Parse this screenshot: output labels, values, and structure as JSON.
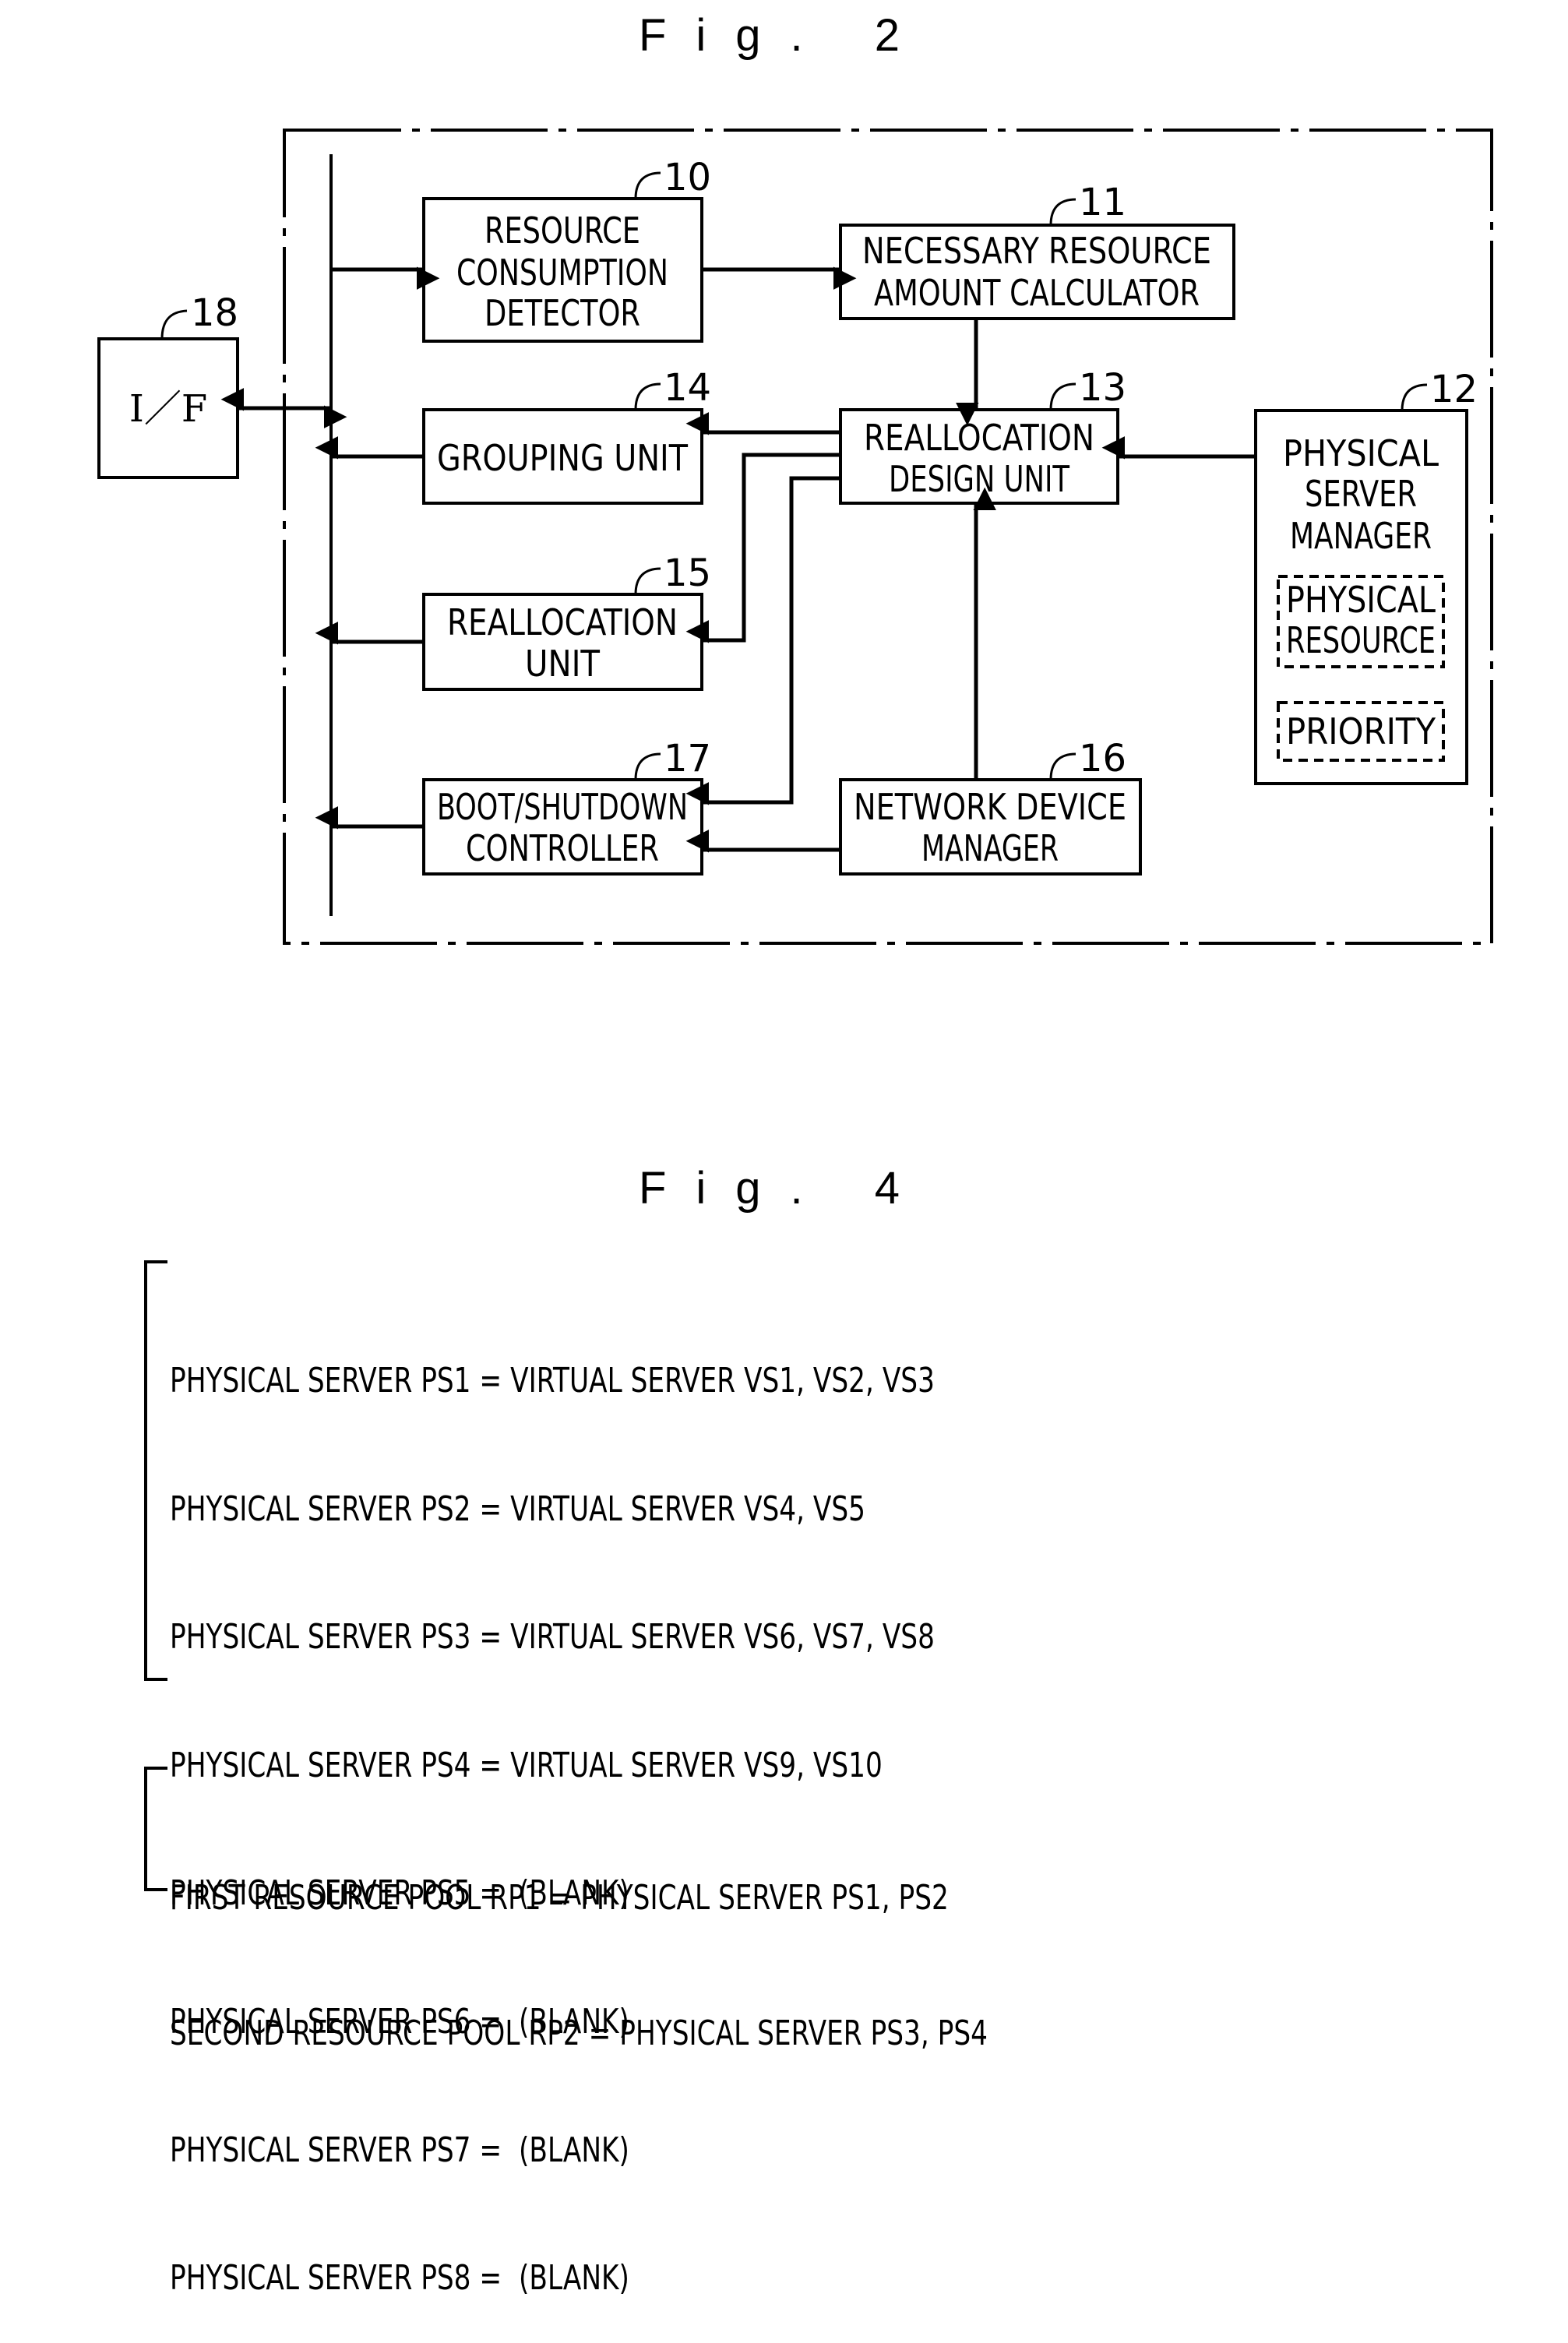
{
  "fig2": {
    "title": "Fig. 2",
    "blocks": {
      "resource_consumption_detector": {
        "ref": "10",
        "lines": [
          "RESOURCE",
          "CONSUMPTION",
          "DETECTOR"
        ]
      },
      "necessary_resource_amount_calculator": {
        "ref": "11",
        "lines": [
          "NECESSARY RESOURCE",
          "AMOUNT CALCULATOR"
        ]
      },
      "physical_server_manager": {
        "ref": "12",
        "lines": [
          "PHYSICAL",
          "SERVER",
          "MANAGER"
        ],
        "sub_items": [
          {
            "lines": [
              "PHYSICAL",
              "RESOURCE"
            ]
          },
          {
            "lines": [
              "PRIORITY"
            ]
          }
        ]
      },
      "reallocation_design_unit": {
        "ref": "13",
        "lines": [
          "REALLOCATION",
          "DESIGN UNIT"
        ]
      },
      "grouping_unit": {
        "ref": "14",
        "lines": [
          "GROUPING UNIT"
        ]
      },
      "reallocation_unit": {
        "ref": "15",
        "lines": [
          "REALLOCATION",
          "UNIT"
        ]
      },
      "network_device_manager": {
        "ref": "16",
        "lines": [
          "NETWORK DEVICE",
          "MANAGER"
        ]
      },
      "boot_shutdown_controller": {
        "ref": "17",
        "lines": [
          "BOOT/SHUTDOWN",
          "CONTROLLER"
        ]
      },
      "interface": {
        "ref": "18",
        "lines": [
          "I／F"
        ]
      }
    }
  },
  "fig4": {
    "title": "Fig. 4",
    "server_assignments": [
      "PHYSICAL SERVER PS1 = VIRTUAL SERVER VS1, VS2, VS3",
      "PHYSICAL SERVER PS2 = VIRTUAL SERVER VS4, VS5",
      "PHYSICAL SERVER PS3 = VIRTUAL SERVER VS6, VS7, VS8",
      "PHYSICAL SERVER PS4 = VIRTUAL SERVER VS9, VS10",
      "PHYSICAL SERVER PS5 =  (BLANK)",
      "PHYSICAL SERVER PS6 =  (BLANK)",
      "PHYSICAL SERVER PS7 =  (BLANK)",
      "PHYSICAL SERVER PS8 =  (BLANK)"
    ],
    "resource_pools": [
      "FIRST RESOURCE POOL RP1 = PHYSICAL SERVER PS1, PS2",
      "SECOND RESOURCE POOL RP2 = PHYSICAL SERVER PS3, PS4"
    ]
  }
}
